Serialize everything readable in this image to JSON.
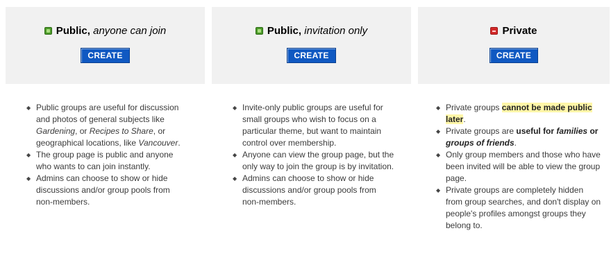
{
  "public_open": {
    "title_main": "Public,",
    "title_em": "anyone can join",
    "icon": "green-square-icon",
    "button": "CREATE",
    "b1": {
      "a": "Public groups are useful for discussion and photos of general subjects like ",
      "i1": "Gardening",
      "c": ", or ",
      "i2": "Recipes to Share",
      "d": ", or geographical locations, like ",
      "i3": "Vancouver",
      "e": "."
    },
    "b2": "The group page is public and anyone who wants to can join instantly.",
    "b3": "Admins can choose to show or hide discussions and/or group pools from non-members."
  },
  "public_invite": {
    "title_main": "Public,",
    "title_em": "invitation only",
    "icon": "green-square-icon",
    "button": "CREATE",
    "b1": "Invite-only public groups are useful for small groups who wish to focus on a particular theme, but want to maintain control over membership.",
    "b2": "Anyone can view the group page, but the only way to join the group is by invitation.",
    "b3": "Admins can choose to show or hide discussions and/or group pools from non-members."
  },
  "private": {
    "title": "Private",
    "icon": "red-minus-icon",
    "button": "CREATE",
    "b1": {
      "a": "Private groups ",
      "hl": "cannot be made public later",
      "b": "."
    },
    "b2": {
      "a": "Private groups are ",
      "bold": "useful for",
      "bi1": "families",
      "or": " or ",
      "bi2": "groups of friends",
      "end": "."
    },
    "b3": "Only group members and those who have been invited will be able to view the group page.",
    "b4": "Private groups are completely hidden from group searches, and don't display on people's profiles amongst groups they belong to."
  }
}
